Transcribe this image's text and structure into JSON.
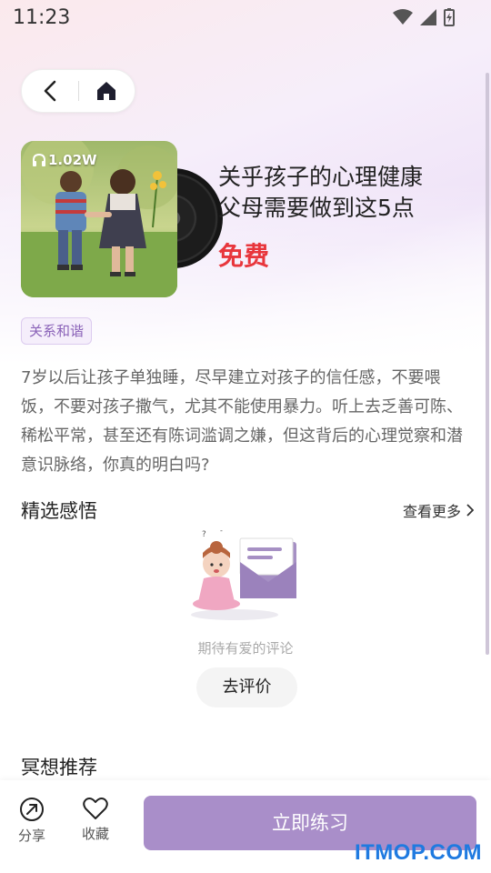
{
  "status_bar": {
    "time": "11:23"
  },
  "cover": {
    "play_count": "1.02W"
  },
  "content": {
    "title_line1": "关乎孩子的心理健康",
    "title_line2": "父母需要做到这5点",
    "price": "免费",
    "tag": "关系和谐",
    "description": "7岁以后让孩子单独睡，尽早建立对孩子的信任感，不要喂饭，不要对孩子撒气，尤其不能使用暴力。听上去乏善可陈、稀松平常，甚至还有陈词滥调之嫌，但这背后的心理觉察和潜意识脉络，你真的明白吗?"
  },
  "reviews": {
    "title": "精选感悟",
    "see_more": "查看更多",
    "empty_text": "期待有爱的评论",
    "review_button": "去评价"
  },
  "meditation": {
    "title": "冥想推荐"
  },
  "bottom_bar": {
    "share_label": "分享",
    "favorite_label": "收藏",
    "practice_button": "立即练习"
  },
  "watermark": "ITMOP.COM",
  "colors": {
    "accent": "#a98ec9",
    "price_red": "#e8363c",
    "tag_text": "#8a62b8"
  }
}
